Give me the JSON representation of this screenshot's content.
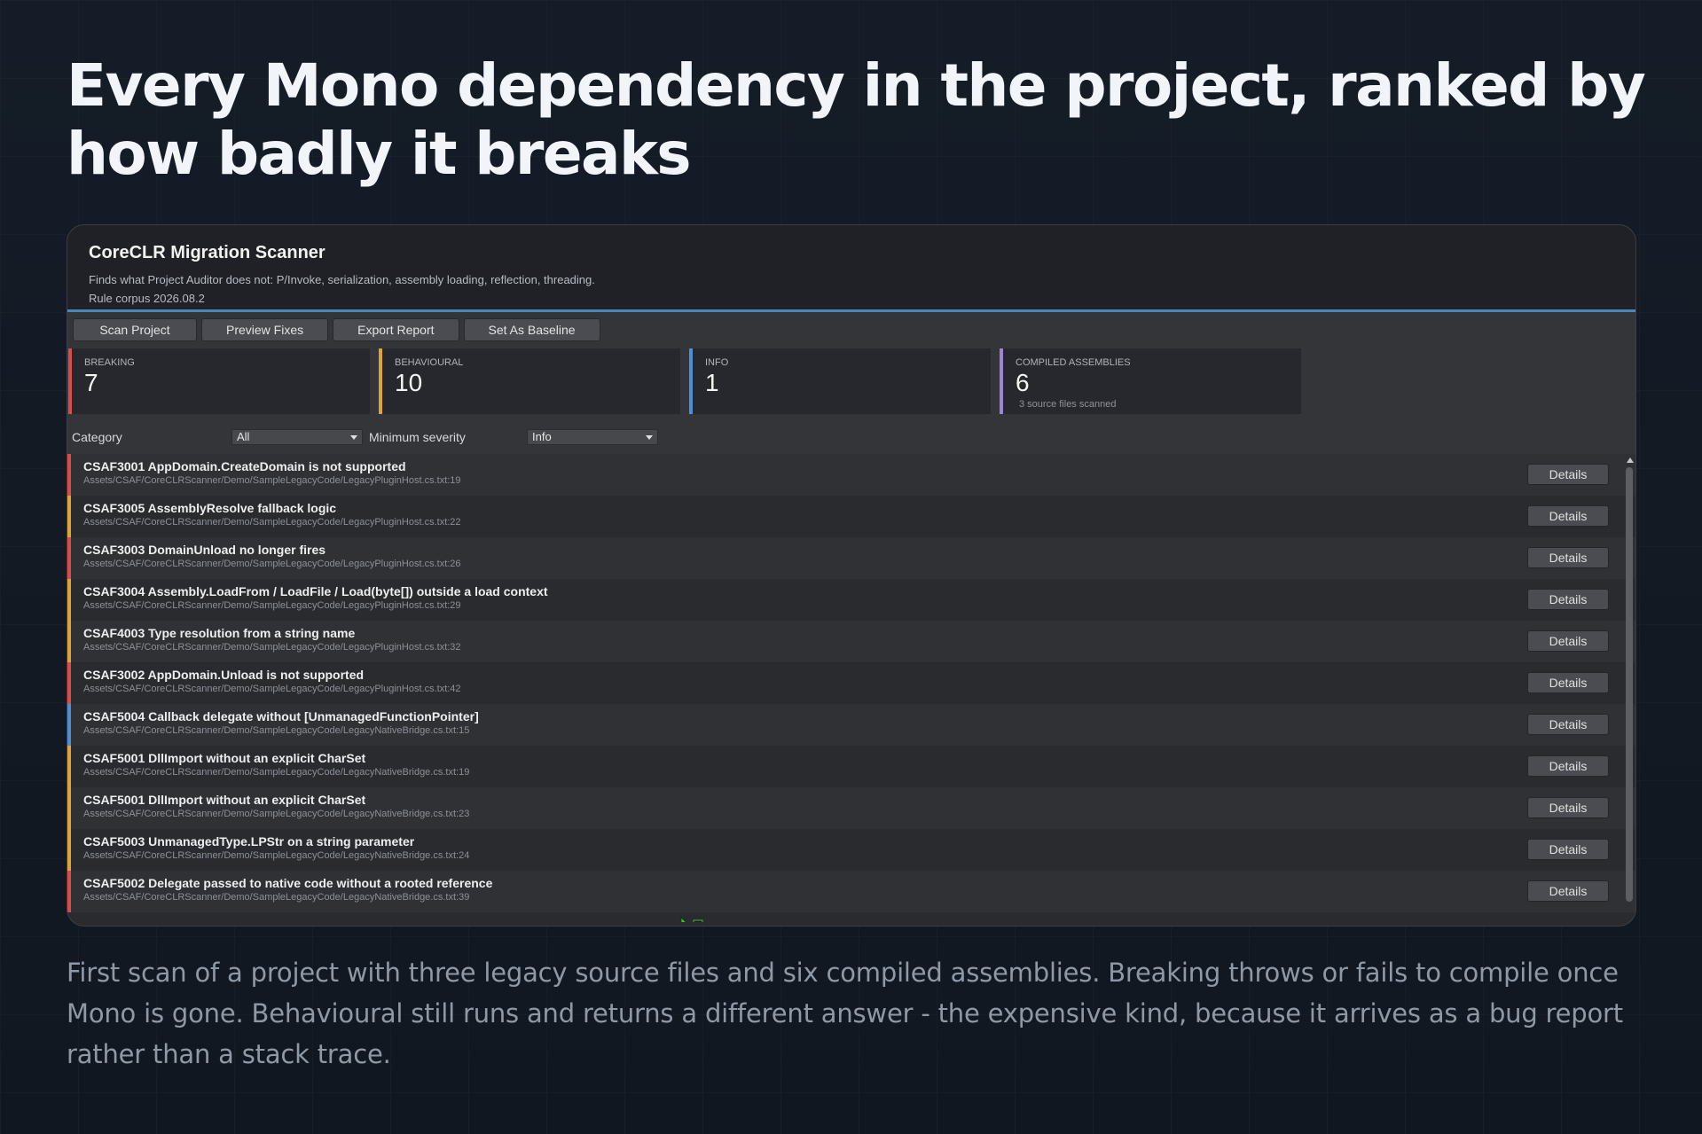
{
  "headline": "Every Mono dependency in the project, ranked by how badly it breaks",
  "window": {
    "title": "CoreCLR Migration Scanner",
    "subtitle": "Finds what Project Auditor does not: P/Invoke, serialization, assembly loading, reflection, threading.",
    "corpus": "Rule corpus 2026.08.2"
  },
  "toolbar": {
    "scan_label": "Scan Project",
    "preview_label": "Preview Fixes",
    "export_label": "Export Report",
    "baseline_label": "Set As Baseline"
  },
  "stats": [
    {
      "label": "BREAKING",
      "value": "7",
      "note": "",
      "color": "#d94c4c"
    },
    {
      "label": "BEHAVIOURAL",
      "value": "10",
      "note": "",
      "color": "#e0a33a"
    },
    {
      "label": "INFO",
      "value": "1",
      "note": "",
      "color": "#4f8fd1"
    },
    {
      "label": "COMPILED ASSEMBLIES",
      "value": "6",
      "note": "3 source files scanned",
      "color": "#9b86d6"
    }
  ],
  "filters": {
    "category_label": "Category",
    "category_value": "All",
    "severity_label": "Minimum severity",
    "severity_value": "Info"
  },
  "findings": [
    {
      "title": "CSAF3001  AppDomain.CreateDomain is not supported",
      "path": "Assets/CSAF/CoreCLRScanner/Demo/SampleLegacyCode/LegacyPluginHost.cs.txt:19",
      "severity_color": "#d94c4c",
      "button": "Details"
    },
    {
      "title": "CSAF3005  AssemblyResolve fallback logic",
      "path": "Assets/CSAF/CoreCLRScanner/Demo/SampleLegacyCode/LegacyPluginHost.cs.txt:22",
      "severity_color": "#e0a33a",
      "button": "Details"
    },
    {
      "title": "CSAF3003  DomainUnload no longer fires",
      "path": "Assets/CSAF/CoreCLRScanner/Demo/SampleLegacyCode/LegacyPluginHost.cs.txt:26",
      "severity_color": "#d94c4c",
      "button": "Details"
    },
    {
      "title": "CSAF3004  Assembly.LoadFrom / LoadFile / Load(byte[]) outside a load context",
      "path": "Assets/CSAF/CoreCLRScanner/Demo/SampleLegacyCode/LegacyPluginHost.cs.txt:29",
      "severity_color": "#e0a33a",
      "button": "Details"
    },
    {
      "title": "CSAF4003  Type resolution from a string name",
      "path": "Assets/CSAF/CoreCLRScanner/Demo/SampleLegacyCode/LegacyPluginHost.cs.txt:32",
      "severity_color": "#e0a33a",
      "button": "Details"
    },
    {
      "title": "CSAF3002  AppDomain.Unload is not supported",
      "path": "Assets/CSAF/CoreCLRScanner/Demo/SampleLegacyCode/LegacyPluginHost.cs.txt:42",
      "severity_color": "#d94c4c",
      "button": "Details"
    },
    {
      "title": "CSAF5004  Callback delegate without [UnmanagedFunctionPointer]",
      "path": "Assets/CSAF/CoreCLRScanner/Demo/SampleLegacyCode/LegacyNativeBridge.cs.txt:15",
      "severity_color": "#4f8fd1",
      "button": "Details"
    },
    {
      "title": "CSAF5001  DllImport without an explicit CharSet",
      "path": "Assets/CSAF/CoreCLRScanner/Demo/SampleLegacyCode/LegacyNativeBridge.cs.txt:19",
      "severity_color": "#e0a33a",
      "button": "Details"
    },
    {
      "title": "CSAF5001  DllImport without an explicit CharSet",
      "path": "Assets/CSAF/CoreCLRScanner/Demo/SampleLegacyCode/LegacyNativeBridge.cs.txt:23",
      "severity_color": "#e0a33a",
      "button": "Details"
    },
    {
      "title": "CSAF5003  UnmanagedType.LPStr on a string parameter",
      "path": "Assets/CSAF/CoreCLRScanner/Demo/SampleLegacyCode/LegacyNativeBridge.cs.txt:24",
      "severity_color": "#e0a33a",
      "button": "Details"
    },
    {
      "title": "CSAF5002  Delegate passed to native code without a rooted reference",
      "path": "Assets/CSAF/CoreCLRScanner/Demo/SampleLegacyCode/LegacyNativeBridge.cs.txt:39",
      "severity_color": "#d94c4c",
      "button": "Details"
    }
  ],
  "caption": "First scan of a project with three legacy source files and six compiled assemblies. Breaking throws or fails to compile once Mono is gone. Behavioural still runs and returns a different answer - the expensive kind, because it arrives as a bug report rather than a stack trace."
}
